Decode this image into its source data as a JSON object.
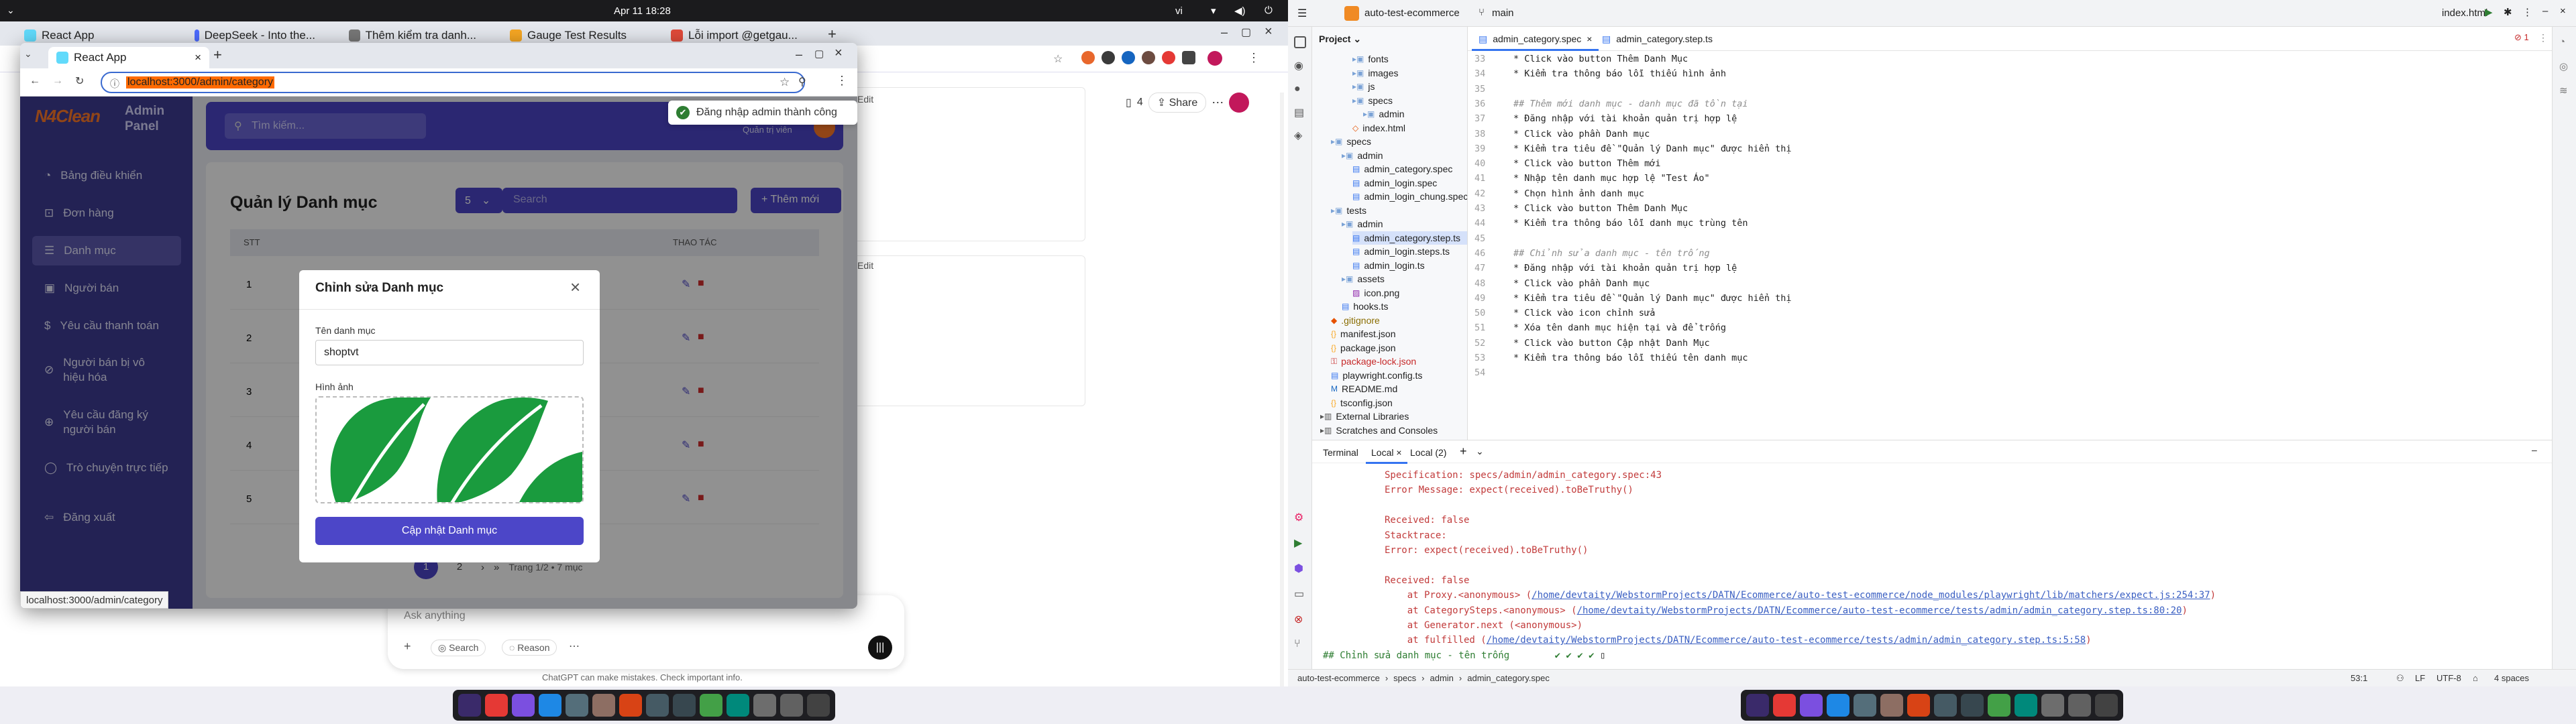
{
  "left": {
    "topbar": {
      "date": "Apr 11 18:28",
      "lang": "vi"
    },
    "chrome_tabs": [
      "React App",
      "DeepSeek - Into the...",
      "Thêm kiểm tra danh...",
      "Gauge Test Results",
      "Lỗi import @getgau..."
    ],
    "bg_content": {
      "edit1": "Edit",
      "edit2": "Edit",
      "share_count": "4",
      "share": "Share",
      "chat_placeholder": "Ask anything",
      "chat_search": "Search",
      "chat_reason": "Reason",
      "chat_disclaimer": "ChatGPT can make mistakes. Check important info."
    },
    "popup": {
      "tab_title": "React App",
      "url": "localhost:3000/admin/category",
      "status_url": "localhost:3000/admin/category"
    },
    "sidebar": {
      "logo": "N4Clean",
      "panel": "Admin Panel",
      "items": [
        {
          "label": "Bảng điều khiển",
          "icon": "dashboard-icon"
        },
        {
          "label": "Đơn hàng",
          "icon": "cart-icon"
        },
        {
          "label": "Danh mục",
          "icon": "list-icon"
        },
        {
          "label": "Người bán",
          "icon": "store-icon"
        },
        {
          "label": "Yêu cầu thanh toán",
          "icon": "payment-icon"
        },
        {
          "label": "Người bán bị vô hiệu hóa",
          "icon": "user-off-icon"
        },
        {
          "label": "Yêu cầu đăng ký người bán",
          "icon": "user-plus-icon"
        },
        {
          "label": "Trò chuyện trực tiếp",
          "icon": "chat-icon"
        },
        {
          "label": "Đăng xuất",
          "icon": "logout-icon"
        }
      ]
    },
    "header": {
      "search_placeholder": "Tìm kiếm...",
      "admin_label": "Quản trị viên"
    },
    "toast": "Đăng nhập admin thành công",
    "page": {
      "title": "Quản lý Danh mục",
      "per_page": "5",
      "search_placeholder": "Search",
      "add_button": "Thêm mới",
      "col_stt": "STT",
      "col_actions": "THAO TÁC",
      "rows": [
        "1",
        "2",
        "3",
        "4",
        "5"
      ],
      "pages": [
        "1",
        "2"
      ],
      "page_info": "Trang 1/2 • 7 mục"
    },
    "modal": {
      "title": "Chỉnh sửa Danh mục",
      "name_label": "Tên danh mục",
      "name_value": "shoptvt",
      "image_label": "Hình ảnh",
      "submit": "Cập nhật Danh mục"
    }
  },
  "right": {
    "project": "auto-test-ecommerce",
    "branch": "main",
    "run_config": "index.html",
    "sidebar_label": "Project",
    "editor_tabs": [
      "admin_category.spec",
      "admin_category.step.ts"
    ],
    "tree": [
      {
        "label": "fonts",
        "kind": "folder",
        "indent": 3
      },
      {
        "label": "images",
        "kind": "folder",
        "indent": 3
      },
      {
        "label": "js",
        "kind": "folder",
        "indent": 3
      },
      {
        "label": "specs",
        "kind": "folder",
        "indent": 3
      },
      {
        "label": "admin",
        "kind": "folder",
        "indent": 4
      },
      {
        "label": "index.html",
        "kind": "html",
        "indent": 3
      },
      {
        "label": "specs",
        "kind": "folder",
        "indent": 1
      },
      {
        "label": "admin",
        "kind": "folder",
        "indent": 2
      },
      {
        "label": "admin_category.spec",
        "kind": "spec",
        "indent": 3
      },
      {
        "label": "admin_login.spec",
        "kind": "spec",
        "indent": 3
      },
      {
        "label": "admin_login_chung.spec",
        "kind": "spec",
        "indent": 3
      },
      {
        "label": "tests",
        "kind": "folder",
        "indent": 1
      },
      {
        "label": "admin",
        "kind": "folder",
        "indent": 2
      },
      {
        "label": "admin_category.step.ts",
        "kind": "ts",
        "indent": 3
      },
      {
        "label": "admin_login.steps.ts",
        "kind": "ts",
        "indent": 3
      },
      {
        "label": "admin_login.ts",
        "kind": "ts",
        "indent": 3
      },
      {
        "label": "assets",
        "kind": "folder",
        "indent": 2
      },
      {
        "label": "icon.png",
        "kind": "png",
        "indent": 3
      },
      {
        "label": "hooks.ts",
        "kind": "ts",
        "indent": 2
      },
      {
        "label": ".gitignore",
        "kind": "git",
        "indent": 1
      },
      {
        "label": "manifest.json",
        "kind": "json",
        "indent": 1
      },
      {
        "label": "package.json",
        "kind": "json",
        "indent": 1
      },
      {
        "label": "package-lock.json",
        "kind": "lock",
        "indent": 1
      },
      {
        "label": "playwright.config.ts",
        "kind": "ts",
        "indent": 1
      },
      {
        "label": "README.md",
        "kind": "md",
        "indent": 1
      },
      {
        "label": "tsconfig.json",
        "kind": "json",
        "indent": 1
      },
      {
        "label": "External Libraries",
        "kind": "lib",
        "indent": 0
      },
      {
        "label": "Scratches and Consoles",
        "kind": "lib",
        "indent": 0
      }
    ],
    "code": [
      {
        "n": "33",
        "t": "* Click vào button Thêm Danh Mục",
        "k": "step"
      },
      {
        "n": "34",
        "t": "* Kiểm tra thông báo lỗi thiếu hình ảnh",
        "k": "step"
      },
      {
        "n": "35",
        "t": "",
        "k": "blank"
      },
      {
        "n": "36",
        "t": "## Thêm mới danh mục - danh mục đã tồn tại",
        "k": "head"
      },
      {
        "n": "37",
        "t": "* Đăng nhập với tài khoản quản trị hợp lệ",
        "k": "step"
      },
      {
        "n": "38",
        "t": "* Click vào phần Danh mục",
        "k": "step"
      },
      {
        "n": "39",
        "t": "* Kiểm tra tiêu đề \"Quản lý Danh mục\" được hiển thị",
        "k": "step"
      },
      {
        "n": "40",
        "t": "* Click vào button Thêm mới",
        "k": "step"
      },
      {
        "n": "41",
        "t": "* Nhập tên danh mục hợp lệ \"Test Áo\"",
        "k": "step"
      },
      {
        "n": "42",
        "t": "* Chọn hình ảnh danh mục",
        "k": "step"
      },
      {
        "n": "43",
        "t": "* Click vào button Thêm Danh Mục",
        "k": "step"
      },
      {
        "n": "44",
        "t": "* Kiểm tra thông báo lỗi danh mục trùng tên",
        "k": "step"
      },
      {
        "n": "45",
        "t": "",
        "k": "blank"
      },
      {
        "n": "46",
        "t": "## Chỉnh sửa danh mục - tên trống",
        "k": "head"
      },
      {
        "n": "47",
        "t": "* Đăng nhập với tài khoản quản trị hợp lệ",
        "k": "step"
      },
      {
        "n": "48",
        "t": "* Click vào phần Danh mục",
        "k": "step"
      },
      {
        "n": "49",
        "t": "* Kiểm tra tiêu đề \"Quản lý Danh mục\" được hiển thị",
        "k": "step"
      },
      {
        "n": "50",
        "t": "* Click vào icon chỉnh sửa",
        "k": "step"
      },
      {
        "n": "51",
        "t": "* Xóa tên danh mục hiện tại và để trống",
        "k": "step"
      },
      {
        "n": "52",
        "t": "* Click vào button Cập nhật Danh Mục",
        "k": "step"
      },
      {
        "n": "53",
        "t": "* Kiểm tra thông báo lỗi thiếu tên danh mục",
        "k": "step"
      },
      {
        "n": "54",
        "t": "",
        "k": "blank"
      }
    ],
    "terminal": {
      "tabs": [
        "Terminal",
        "Local",
        "Local (2)"
      ],
      "lines": [
        {
          "t": "Specification: specs/admin/admin_category.spec:43",
          "k": "err"
        },
        {
          "t": "Error Message: expect(received).toBeTruthy()",
          "k": "err"
        },
        {
          "t": "",
          "k": "err"
        },
        {
          "t": "Received: false",
          "k": "err"
        },
        {
          "t": "Stacktrace:",
          "k": "err"
        },
        {
          "t": "Error: expect(received).toBeTruthy()",
          "k": "err"
        },
        {
          "t": "",
          "k": "err"
        },
        {
          "t": "Received: false",
          "k": "err"
        },
        {
          "t": "    at Proxy.<anonymous> (",
          "k": "err",
          "link": "/home/devtaity/WebstormProjects/DATN/Ecommerce/auto-test-ecommerce/node_modules/playwright/lib/matchers/expect.js:254:37",
          "end": ")"
        },
        {
          "t": "    at CategorySteps.<anonymous> (",
          "k": "err",
          "link": "/home/devtaity/WebstormProjects/DATN/Ecommerce/auto-test-ecommerce/tests/admin/admin_category.step.ts:80:20",
          "end": ")"
        },
        {
          "t": "    at Generator.next (<anonymous>)",
          "k": "err"
        },
        {
          "t": "    at fulfilled (",
          "k": "err",
          "link": "/home/devtaity/WebstormProjects/DATN/Ecommerce/auto-test-ecommerce/tests/admin/admin_category.step.ts:5:58",
          "end": ")"
        }
      ],
      "last_line": "## Chỉnh sửa danh mục - tên trống",
      "marks": "✔ ✔ ✔ ✔"
    },
    "status": {
      "path": [
        "auto-test-ecommerce",
        "specs",
        "admin",
        "admin_category.spec"
      ],
      "position": "53:1",
      "line_sep": "LF",
      "encoding": "UTF-8",
      "indent": "4 spaces"
    }
  },
  "colors": {
    "sidebar": "#3f3c94",
    "primary": "#4c46c8",
    "ide_bg": "#ffffff",
    "error": "#c23b3b"
  }
}
